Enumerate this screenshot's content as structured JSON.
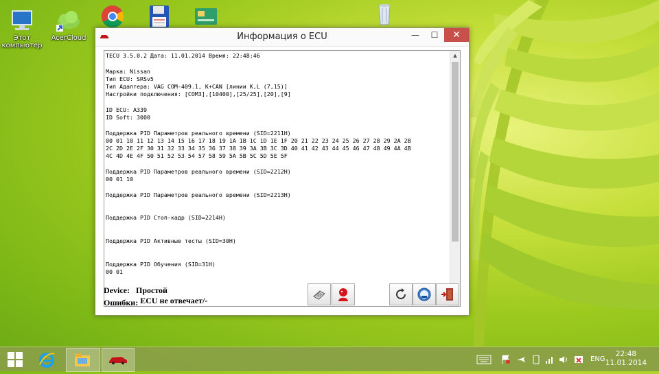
{
  "desktop": {
    "icons": [
      {
        "name": "computer",
        "label_line1": "Этот",
        "label_line2": "компьютер"
      },
      {
        "name": "acercloud",
        "label_line1": "AcerCloud",
        "label_line2": ""
      },
      {
        "name": "chrome",
        "label_line1": "",
        "label_line2": ""
      },
      {
        "name": "floppy",
        "label_line1": "",
        "label_line2": ""
      },
      {
        "name": "card",
        "label_line1": "",
        "label_line2": ""
      },
      {
        "name": "recycle-bin",
        "label_line1": "",
        "label_line2": ""
      }
    ]
  },
  "window": {
    "title": "Информация о ECU",
    "minimize_glyph": "—",
    "maximize_glyph": "☐",
    "close_glyph": "✕",
    "log_lines": [
      "TECU 3.5.0.2 Дата: 11.01.2014 Время: 22:48:46",
      "",
      "Марка: Nissan",
      "Тип ECU: SRSv5",
      "Тип Адаптера: VAG COM-409.1, K+CAN [линии K,L (7,15)]",
      "Настройки подключения: [COM3],[10400],[25/25],[20],[9]",
      "",
      "ID ECU: A339",
      "ID Soft: 3000",
      "",
      "Поддержка PID Параметров реального времени (SID=2211H)",
      "00 01 10 11 12 13 14 15 16 17 18 19 1A 1B 1C 1D 1E 1F 20 21 22 23 24 25 26 27 28 29 2A 2B",
      "2C 2D 2E 2F 30 31 32 33 34 35 36 37 38 39 3A 3B 3C 3D 40 41 42 43 44 45 46 47 48 49 4A 4B",
      "4C 4D 4E 4F 50 51 52 53 54 57 58 59 5A 5B 5C 5D 5E 5F",
      "",
      "Поддержка PID Параметров реального времени (SID=2212H)",
      "00 01 10",
      "",
      "Поддержка PID Параметров реального времени (SID=2213H)",
      "",
      "",
      "Поддержка PID Стоп-кадр (SID=2214H)",
      "",
      "",
      "Поддержка PID Активные тесты (SID=30H)",
      "",
      "",
      "Поддержка PID Обучения (SID=31H)",
      "00 01"
    ],
    "scroll_up": "▲",
    "scroll_down": "▼",
    "status": {
      "device_label": "Device:",
      "device_value": "Простой",
      "errors_label": "Ошибки:",
      "errors_value": "ECU не отвечает/-"
    },
    "toolbar": [
      {
        "name": "connect-button",
        "icon": "plug-icon"
      },
      {
        "name": "person-button",
        "icon": "person-icon"
      },
      {
        "name": "refresh-button",
        "icon": "refresh-icon"
      },
      {
        "name": "info-button",
        "icon": "info-icon"
      },
      {
        "name": "exit-button",
        "icon": "exit-door-icon"
      }
    ]
  },
  "taskbar": {
    "start_icon": "windows-start-icon",
    "pinned": [
      "internet-explorer-icon",
      "file-explorer-icon",
      "tecu-car-icon"
    ],
    "tray_language": "ENG",
    "clock_time": "22:48",
    "clock_date": "11.01.2014"
  },
  "colors": {
    "close_button": "#c7504b",
    "desktop_green": "#9cc91e",
    "taskbar": "#8aa046"
  }
}
